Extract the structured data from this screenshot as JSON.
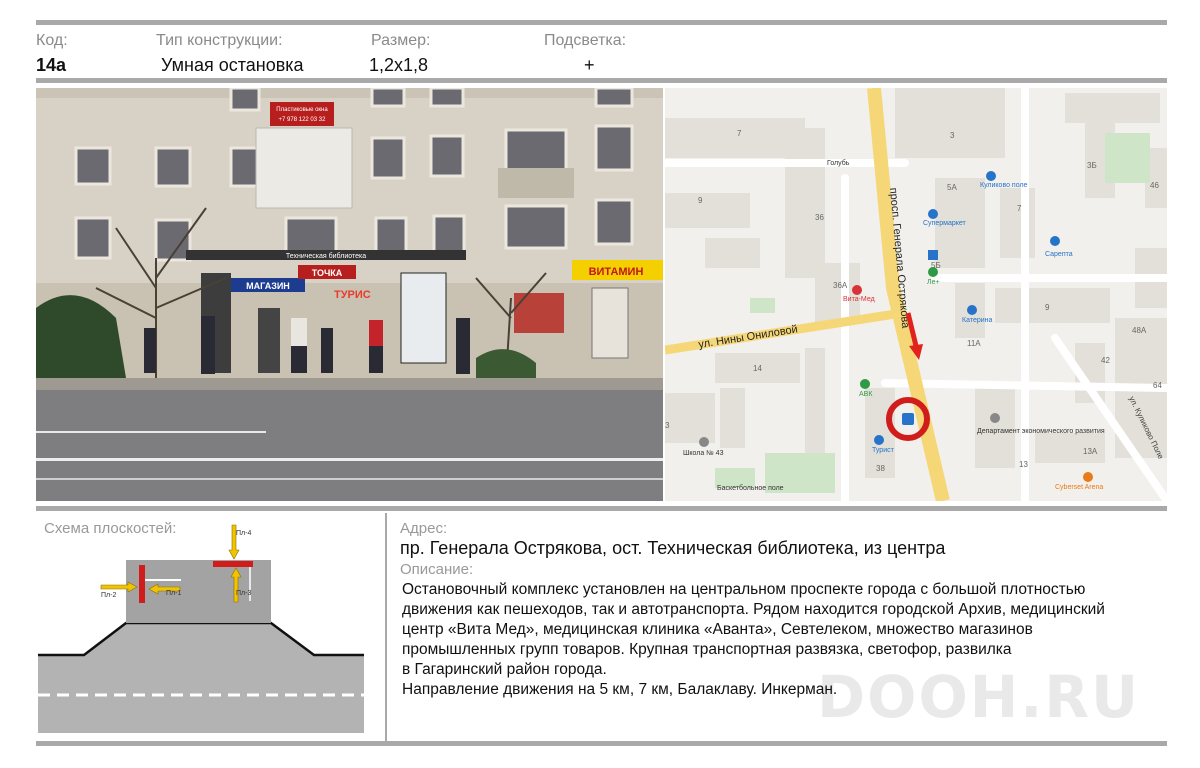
{
  "header": {
    "code_label": "Код:",
    "code_value": "14а",
    "type_label": "Тип конструкции:",
    "type_value": "Умная остановка",
    "size_label": "Размер:",
    "size_value": "1,2x1,8",
    "light_label": "Подсветка:",
    "light_value": "+"
  },
  "photo": {
    "sign_shop": "МАГАЗИН",
    "sign_tochka": "ТОЧКА",
    "sign_vitamin": "ВИТАМИН",
    "sign_stop": "Техническая библиотека",
    "sign_turis": "ТУРИС",
    "sign_balcony_top": "Пластиковые окна",
    "sign_balcony_phone": "+7 978 122 03 32"
  },
  "map": {
    "street_main": "просп. Генерала Острякова",
    "street_side": "ул. Нины Ониловой",
    "street_kulikovo": "ул. Куликово Поле",
    "poi_golub": "Голубь",
    "poi_kulikovo": "Куликово поле",
    "poi_supermarket": "Супермаркет",
    "poi_sareta": "Сарепта",
    "poi_vitamed": "Вита-Мед",
    "poi_le": "Ле+",
    "poi_katerina": "Катерина",
    "poi_avk": "АВК",
    "poi_turist": "Турист",
    "poi_school": "Школа № 43",
    "poi_basket": "Баскетбольное поле",
    "poi_dep": "Департамент экономического развития",
    "poi_cyber": "Cyberset Arena",
    "b_7a": "7",
    "b_3": "3",
    "b_3b": "3Б",
    "b_9": "9",
    "b_5a": "5А",
    "b_7b": "7",
    "b_46": "46",
    "b_36": "36",
    "b_5b": "5Б",
    "b_36a": "36А",
    "b_11a": "11А",
    "b_9b": "9",
    "b_48a": "48А",
    "b_42": "42",
    "b_14": "14",
    "b_64": "64",
    "b_13": "13",
    "b_13a": "13А",
    "b_38": "38",
    "b_3c": "3"
  },
  "scheme": {
    "label": "Схема плоскостей:",
    "p1": "Пл-1",
    "p2": "Пл-2",
    "p3": "Пл-3",
    "p4": "Пл-4"
  },
  "info": {
    "address_label": "Адрес:",
    "address_value": "пр. Генерала Острякова, ост. Техническая библиотека, из центра",
    "desc_label": "Описание:",
    "desc_lines": [
      "Остановочный комплекс установлен на центральном проспекте города с большой плотностью",
      "движения как пешеходов, так и автотранспорта. Рядом находится городской Архив, медицинский",
      "центр «Вита Мед», медицинская клиника «Аванта», Севтелеком, множество магазинов",
      "промышленных групп товаров. Крупная транспортная развязка, светофор, развилка",
      "в Гагаринский район города.",
      "Направление движения на 5 км, 7 км, Балаклаву. Инкерман."
    ],
    "watermark": "DOOH.RU"
  },
  "colors": {
    "rule": "#a9a9a9",
    "road": "#b3b3b3",
    "red": "#d11c1c",
    "yellow": "#f2c400",
    "map_road": "#f6d777"
  }
}
